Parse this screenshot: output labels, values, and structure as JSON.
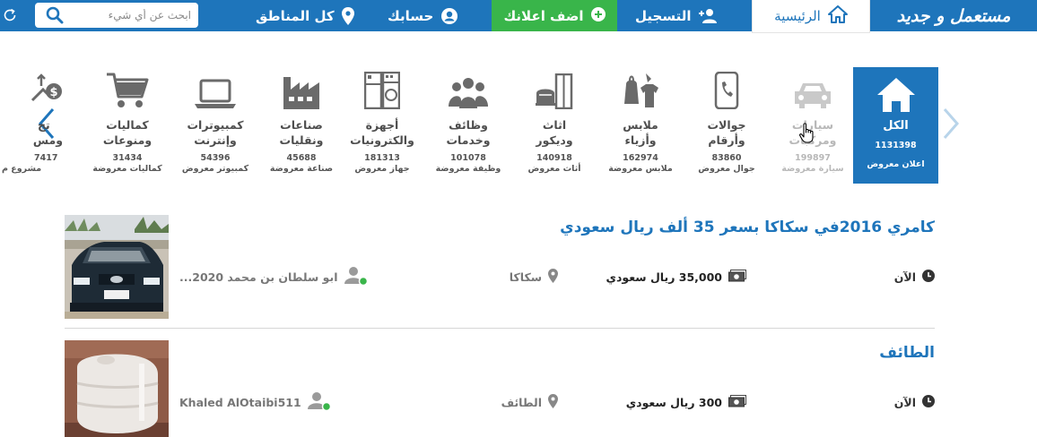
{
  "brand": {
    "logo_text": "مستعمل و جديد",
    "primary_color": "#1e75bb",
    "accent_color": "#39b54a"
  },
  "nav": {
    "home_label": "الرئيسية",
    "register_label": "التسجيل",
    "post_ad_label": "اضف اعلانك",
    "account_label": "حسابك",
    "regions_label": "كل المناطق",
    "search_placeholder": "ابحث عن أي شيء"
  },
  "categories": [
    {
      "name_line1": "الكل",
      "name_line2": "",
      "count": "1131398",
      "unit": "اعلان معروض",
      "icon": "home-icon",
      "active": true
    },
    {
      "name_line1": "سيارات",
      "name_line2": "ومركبات",
      "count": "199897",
      "unit": "سيارة معروضة",
      "icon": "car-icon"
    },
    {
      "name_line1": "جوالات",
      "name_line2": "وأرقام",
      "count": "83860",
      "unit": "جوال معروض",
      "icon": "mobile-icon"
    },
    {
      "name_line1": "ملابس",
      "name_line2": "وأزياء",
      "count": "162974",
      "unit": "ملابس معروضة",
      "icon": "clothes-icon"
    },
    {
      "name_line1": "اثاث",
      "name_line2": "وديكور",
      "count": "140918",
      "unit": "أثاث معروض",
      "icon": "furniture-icon"
    },
    {
      "name_line1": "وظائف",
      "name_line2": "وخدمات",
      "count": "101078",
      "unit": "وظيفة معروضة",
      "icon": "people-icon"
    },
    {
      "name_line1": "أجهزة",
      "name_line2": "والكترونيات",
      "count": "181313",
      "unit": "جهاز معروض",
      "icon": "appliances-icon"
    },
    {
      "name_line1": "صناعات",
      "name_line2": "ونقليات",
      "count": "45688",
      "unit": "صناعة معروضة",
      "icon": "factory-icon"
    },
    {
      "name_line1": "كمبيوترات",
      "name_line2": "وإنترنت",
      "count": "54396",
      "unit": "كمبيوتر معروض",
      "icon": "laptop-icon"
    },
    {
      "name_line1": "كماليات",
      "name_line2": "ومنوعات",
      "count": "31434",
      "unit": "كماليات معروضة",
      "icon": "cart-icon"
    },
    {
      "name_line1": "تج",
      "name_line2": "ومس",
      "count": "7417",
      "unit": "مشروع م",
      "icon": "business-icon"
    }
  ],
  "listings": [
    {
      "title": "كامري 2016في سكاكا بسعر 35 ألف ريال سعودي",
      "time": "الآن",
      "price": "35,000 ريال سعودي",
      "city": "سكاكا",
      "user": "ابو سلطان بن محمد 2020..."
    },
    {
      "title": "الطائف",
      "time": "الآن",
      "price": "300 ريال سعودي",
      "city": "الطائف",
      "user": "Khaled AlOtaibi511"
    }
  ]
}
